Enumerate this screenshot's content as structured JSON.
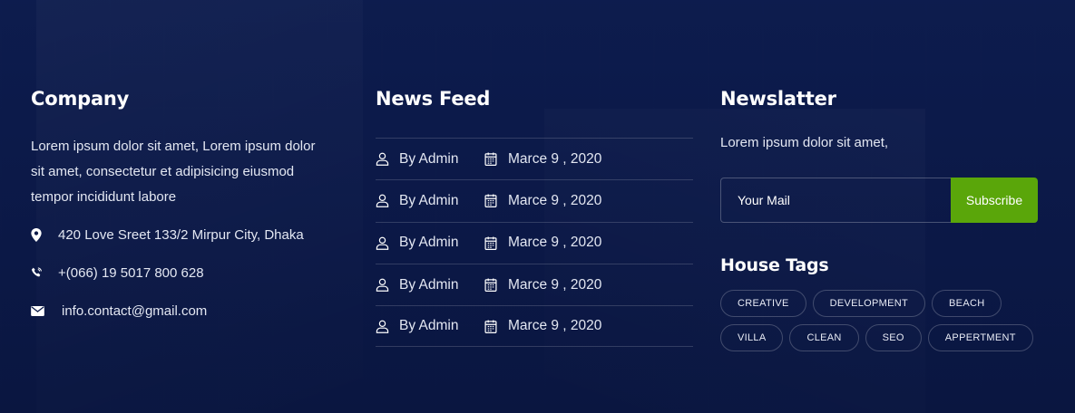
{
  "company": {
    "title": "Company",
    "about_lines": [
      "Lorem ipsum dolor sit amet, Lorem ipsum dolor",
      "sit amet, consectetur et adipisicing eiusmod",
      "tempor incididunt labore"
    ],
    "address": "420 Love Sreet 133/2 Mirpur City, Dhaka",
    "phone": "+(066) 19 5017 800 628",
    "email": "info.contact@gmail.com"
  },
  "news": {
    "title": "News Feed",
    "items": [
      {
        "author": "By Admin",
        "date": "Marce 9 , 2020"
      },
      {
        "author": "By Admin",
        "date": "Marce 9 , 2020"
      },
      {
        "author": "By Admin",
        "date": "Marce 9 , 2020"
      },
      {
        "author": "By Admin",
        "date": "Marce 9 , 2020"
      },
      {
        "author": "By Admin",
        "date": "Marce 9 , 2020"
      }
    ]
  },
  "newsletter": {
    "title": "Newslatter",
    "intro": "Lorem ipsum dolor sit amet,",
    "placeholder": "Your Mail",
    "button_label": "Subscribe",
    "button_color": "#5aa60a"
  },
  "tags": {
    "title": "House Tags",
    "items": [
      "CREATIVE",
      "DEVELOPMENT",
      "BEACH",
      "VILLA",
      "CLEAN",
      "SEO",
      "APPERTMENT"
    ]
  },
  "theme": {
    "background": "#0c1a48",
    "text": "#ffffff",
    "icons": [
      "location-pin-icon",
      "phone-icon",
      "envelope-icon",
      "user-icon",
      "calendar-icon"
    ]
  }
}
